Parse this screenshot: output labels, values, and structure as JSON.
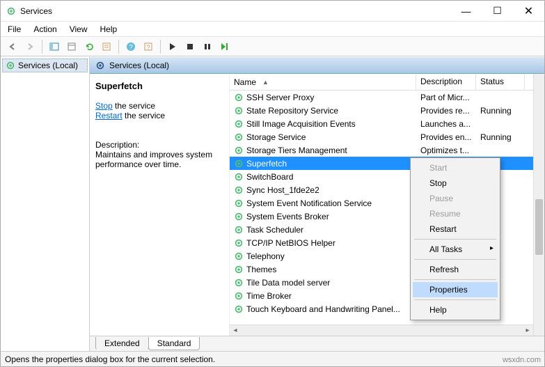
{
  "window": {
    "title": "Services"
  },
  "menubar": [
    "File",
    "Action",
    "View",
    "Help"
  ],
  "tree": {
    "root": "Services (Local)"
  },
  "header": {
    "title": "Services (Local)"
  },
  "detail": {
    "selected_name": "Superfetch",
    "stop_link": "Stop",
    "stop_suffix": " the service",
    "restart_link": "Restart",
    "restart_suffix": " the service",
    "desc_label": "Description:",
    "desc_text": "Maintains and improves system performance over time."
  },
  "columns": {
    "name": "Name",
    "desc": "Description",
    "status": "Status"
  },
  "rows": [
    {
      "name": "SSH Server Proxy",
      "desc": "Part of Micr...",
      "status": ""
    },
    {
      "name": "State Repository Service",
      "desc": "Provides re...",
      "status": "Running"
    },
    {
      "name": "Still Image Acquisition Events",
      "desc": "Launches a...",
      "status": ""
    },
    {
      "name": "Storage Service",
      "desc": "Provides en...",
      "status": "Running"
    },
    {
      "name": "Storage Tiers Management",
      "desc": "Optimizes t...",
      "status": ""
    },
    {
      "name": "Superfetch",
      "desc": "",
      "status": "nning",
      "selected": true
    },
    {
      "name": "SwitchBoard",
      "desc": "",
      "status": ""
    },
    {
      "name": "Sync Host_1fde2e2",
      "desc": "",
      "status": "nning"
    },
    {
      "name": "System Event Notification Service",
      "desc": "",
      "status": "nning"
    },
    {
      "name": "System Events Broker",
      "desc": "",
      "status": "nning"
    },
    {
      "name": "Task Scheduler",
      "desc": "",
      "status": "nning"
    },
    {
      "name": "TCP/IP NetBIOS Helper",
      "desc": "",
      "status": "nning"
    },
    {
      "name": "Telephony",
      "desc": "",
      "status": "nning"
    },
    {
      "name": "Themes",
      "desc": "",
      "status": "nning"
    },
    {
      "name": "Tile Data model server",
      "desc": "",
      "status": "nning"
    },
    {
      "name": "Time Broker",
      "desc": "",
      "status": "nning"
    },
    {
      "name": "Touch Keyboard and Handwriting Panel...",
      "desc": "",
      "status": "nning"
    }
  ],
  "ctx": {
    "items": [
      {
        "label": "Start",
        "disabled": true
      },
      {
        "label": "Stop"
      },
      {
        "label": "Pause",
        "disabled": true
      },
      {
        "label": "Resume",
        "disabled": true
      },
      {
        "label": "Restart"
      },
      {
        "sep": true
      },
      {
        "label": "All Tasks",
        "sub": true
      },
      {
        "sep": true
      },
      {
        "label": "Refresh"
      },
      {
        "sep": true
      },
      {
        "label": "Properties",
        "hl": true
      },
      {
        "sep": true
      },
      {
        "label": "Help"
      }
    ]
  },
  "tabs": {
    "extended": "Extended",
    "standard": "Standard"
  },
  "statusbar": "Opens the properties dialog box for the current selection.",
  "watermark": "wsxdn.com"
}
